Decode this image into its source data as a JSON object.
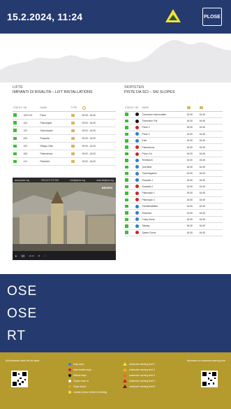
{
  "header": {
    "datetime": "15.2.2024, 11:24",
    "logo": "PLOSE"
  },
  "lifts": {
    "title": "LIFTE",
    "subtitle": "IMPIANTI DI RISALITA – LIFT INSTALLATIONS",
    "columns": [
      "STATUS",
      "NR",
      "NAME",
      "TYPE",
      ""
    ],
    "rows": [
      {
        "nr": "100+101",
        "name": "Plose",
        "time": "08:45 - 16:30"
      },
      {
        "nr": "104",
        "name": "Pfannegele",
        "time": "09:00 - 16:30"
      },
      {
        "nr": "102",
        "name": "Schönboden",
        "time": "09:00 - 16:30"
      },
      {
        "nr": "105",
        "name": "Rossetta",
        "time": "09:00 - 16:30"
      },
      {
        "nr": "103",
        "name": "Rifugio Città",
        "time": "09:00 - 16:30"
      },
      {
        "nr": "106",
        "name": "Palmschoss",
        "time": "09:00 - 16:30"
      },
      {
        "nr": "114",
        "name": "Rinnbichl",
        "time": "09:00 - 16:30"
      }
    ]
  },
  "slopes": {
    "title": "SKIPISTEN",
    "subtitle": "PISTE DA SCI – SKI SLOPES",
    "columns": [
      "STATUS",
      "NR",
      "NAME",
      "",
      ""
    ],
    "rows": [
      {
        "nr": "1",
        "name": "Trametsch intermediate",
        "color": "#111111",
        "open": "16:30",
        "close": "16:45"
      },
      {
        "nr": "2",
        "name": "Trametsch Full",
        "color": "#111111",
        "open": "16:30",
        "close": "16:45"
      },
      {
        "nr": "2",
        "name": "Plose 2",
        "color": "#d92020",
        "open": "16:30",
        "close": "16:45"
      },
      {
        "nr": "3",
        "name": "Plose 3",
        "color": "#2a7fd0",
        "open": "16:30",
        "close": "16:45"
      },
      {
        "nr": "4",
        "name": "Erler",
        "color": "#2a7fd0",
        "open": "16:30",
        "close": "16:45"
      },
      {
        "nr": "5",
        "name": "Palmschoss",
        "color": "#d92020",
        "open": "16:30",
        "close": "16:45"
      },
      {
        "nr": "6",
        "name": "Plose Col",
        "color": "#d92020",
        "open": "16:30",
        "close": "16:45"
      },
      {
        "nr": "7",
        "name": "Rennbach",
        "color": "#2a7fd0",
        "open": "16:30",
        "close": "16:45"
      },
      {
        "nr": "8",
        "name": "Querfahrt",
        "color": "#2a7fd0",
        "open": "16:30",
        "close": "16:45"
      },
      {
        "nr": "9",
        "name": "Trametsgarten",
        "color": "#2a7fd0",
        "open": "16:30",
        "close": "16:45"
      },
      {
        "nr": "10",
        "name": "Rossalm 1",
        "color": "#2a7fd0",
        "open": "16:30",
        "close": "16:45"
      },
      {
        "nr": "11",
        "name": "Rossalm 2",
        "color": "#d92020",
        "open": "16:30",
        "close": "16:45"
      },
      {
        "nr": "12",
        "name": "Pfannspitz 1",
        "color": "#d92020",
        "open": "16:30",
        "close": "16:45"
      },
      {
        "nr": "13",
        "name": "Pfannspitz 2",
        "color": "#d92020",
        "open": "16:30",
        "close": "16:45"
      },
      {
        "nr": "14",
        "name": "Familienabfahrt",
        "color": "#2a7fd0",
        "open": "16:30",
        "close": "16:45"
      },
      {
        "nr": "15",
        "name": "Rinnbichl",
        "color": "#2a7fd0",
        "open": "16:30",
        "close": "16:45"
      },
      {
        "nr": "16",
        "name": "Crazy Horse",
        "color": "#2a7fd0",
        "open": "16:30",
        "close": "16:45"
      },
      {
        "nr": "17",
        "name": "Skiweg",
        "color": "#2a7fd0",
        "open": "16:30",
        "close": "16:45"
      },
      {
        "nr": "18",
        "name": "Speed Check",
        "color": "#d92020",
        "open": "16:30",
        "close": "16:45"
      }
    ]
  },
  "webcam": {
    "site": "www.plose.org",
    "phone": "+39 0472 270 333",
    "email": "info@plose.org",
    "url": "www.skiplose.org",
    "place": "BRIXEN",
    "clock": "11:24"
  },
  "words": [
    "OSE",
    "OSE",
    "RT"
  ],
  "footer": {
    "left_info": "All information about the ski report",
    "right_info": "Information on avalanche warning level",
    "legend_slopes": [
      "Easy slope",
      "Intermediate slope",
      "Difficult slope",
      "Slopes close at",
      "Slope closed",
      "Location (snow vehicle & booking)"
    ],
    "legend_warning": [
      "Avalanche warning level 1",
      "Avalanche warning level 2",
      "Avalanche warning level 3",
      "Avalanche warning level 4",
      "Avalanche warning level 5"
    ]
  }
}
